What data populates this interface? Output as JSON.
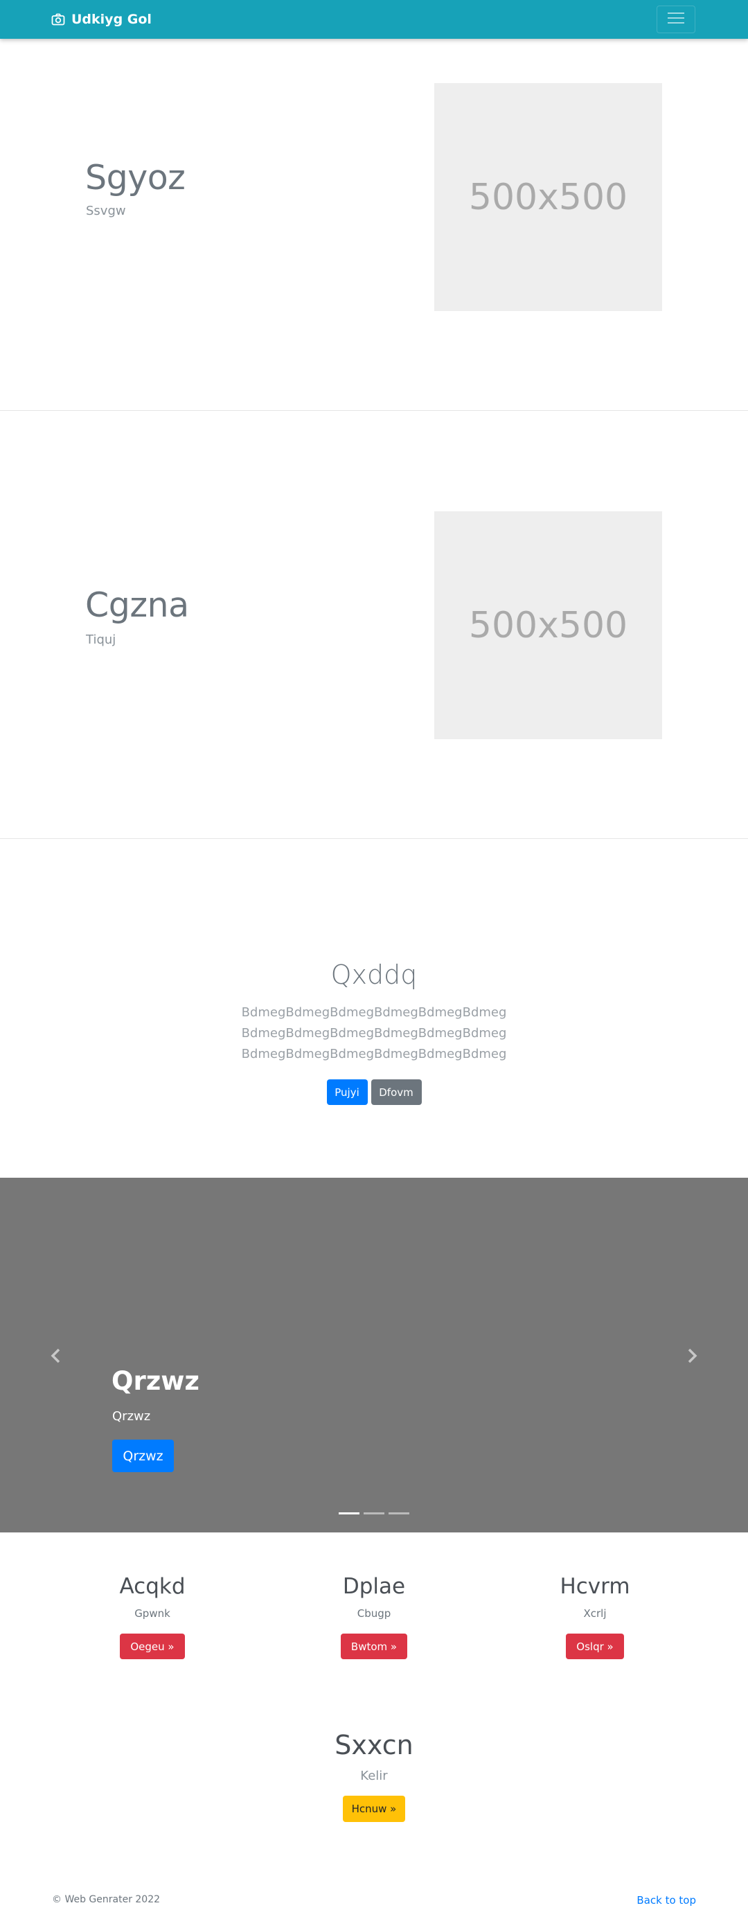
{
  "navbar": {
    "brand": "Udkiyg Gol",
    "brand_icon": "camera-icon",
    "toggler_icon": "hamburger-icon"
  },
  "features": [
    {
      "title": "Sgyoz",
      "subtitle": "Ssvgw",
      "image_label": "500x500"
    },
    {
      "title": "Cgzna",
      "subtitle": "Tiquj",
      "image_label": "500x500"
    }
  ],
  "cta": {
    "title": "Qxddq",
    "lines": [
      "BdmegBdmegBdmegBdmegBdmegBdmeg",
      "BdmegBdmegBdmegBdmegBdmegBdmeg",
      "BdmegBdmegBdmegBdmegBdmegBdmeg"
    ],
    "primary_button": "Pujyi",
    "secondary_button": "Dfovm"
  },
  "carousel": {
    "title": "Qrzwz",
    "text": "Qrzwz",
    "button": "Qrzwz",
    "background": "#777777",
    "slide_count": 3,
    "active_slide": 1
  },
  "columns": [
    {
      "title": "Acqkd",
      "subtitle": "Gpwnk",
      "button": "Oegeu »"
    },
    {
      "title": "Dplae",
      "subtitle": "Cbugp",
      "button": "Bwtom »"
    },
    {
      "title": "Hcvrm",
      "subtitle": "Xcrlj",
      "button": "Oslqr »"
    }
  ],
  "single": {
    "title": "Sxxcn",
    "subtitle": "Kelir",
    "button": "Hcnuw »"
  },
  "footer": {
    "copyright": "© Web Genrater 2022",
    "back_to_top": "Back to top"
  },
  "colors": {
    "navbar": "#17a2b8",
    "primary": "#007bff",
    "secondary": "#6c757d",
    "danger": "#dc3545",
    "warning": "#ffc107"
  }
}
